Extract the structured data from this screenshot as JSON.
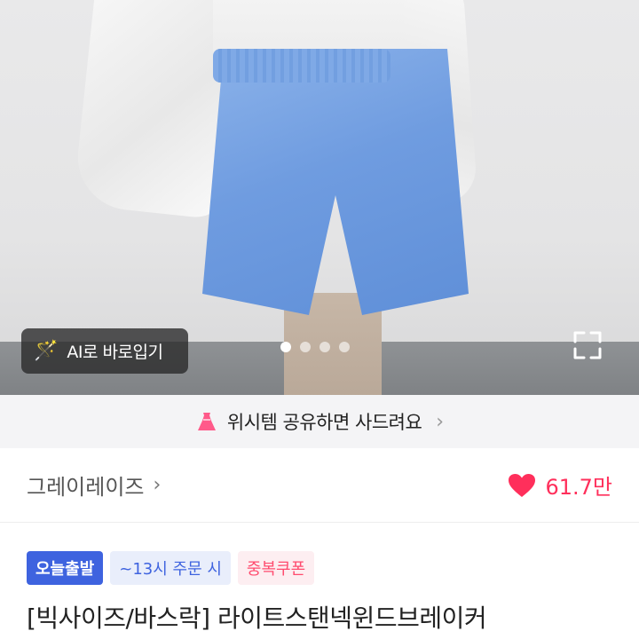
{
  "product_image": {
    "ai_button_label": "AI로 바로입기",
    "carousel": {
      "total": 4,
      "active_index": 0
    }
  },
  "share_banner": {
    "text": "위시템 공유하면 사드려요"
  },
  "store": {
    "name": "그레이레이즈",
    "likes": "61.7만"
  },
  "tags": {
    "today_ship": "오늘출발",
    "cutoff": "~13시 주문 시",
    "coupon": "중복쿠폰"
  },
  "product": {
    "title": "[빅사이즈/바스락] 라이트스탠넥윈드브레이커"
  },
  "colors": {
    "heart": "#ff2f5b",
    "tag_blue": "#3e63df",
    "coupon_pink": "#ff4b6e",
    "dress_pink": "#ff5a8a"
  }
}
